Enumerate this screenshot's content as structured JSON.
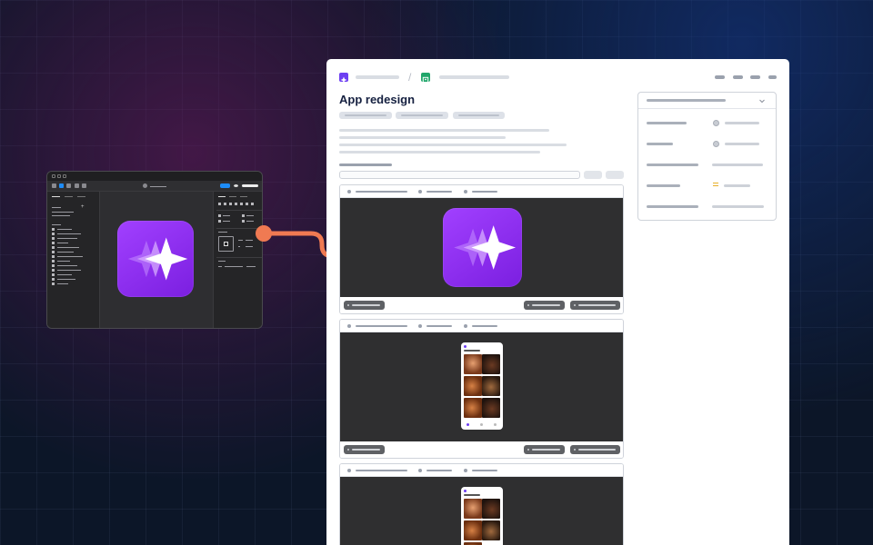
{
  "document": {
    "title": "App redesign"
  },
  "colors": {
    "background": "#0c1628",
    "connector": "#f07a52",
    "app_icon_start": "#a140ff",
    "app_icon_end": "#7b1fe0",
    "document_panel": "#ffffff",
    "card_body": "#2f2f30",
    "toolbar_accent": "#1d8cf8",
    "logo_primary": "#6d3ff2",
    "logo_secondary": "#21a66b"
  },
  "icons": {
    "app": "sparkle-stars-icon",
    "workspace_logo": "sparkle-logo-icon",
    "project_logo": "contact-card-icon",
    "chevron": "chevron-down-icon",
    "assignee": "person-icon",
    "priority": "priority-medium-icon"
  }
}
